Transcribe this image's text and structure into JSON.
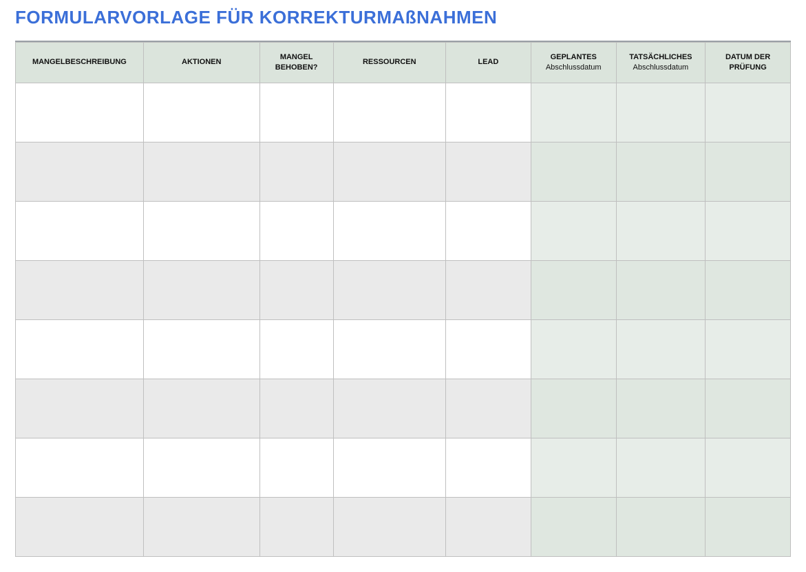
{
  "title": "FORMULARVORLAGE FÜR KORREKTURMAßNAHMEN",
  "columns": [
    {
      "header_bold": "MANGELBESCHREIBUNG",
      "header_sub": ""
    },
    {
      "header_bold": "AKTIONEN",
      "header_sub": ""
    },
    {
      "header_bold": "MANGEL BEHOBEN?",
      "header_sub": ""
    },
    {
      "header_bold": "RESSOURCEN",
      "header_sub": ""
    },
    {
      "header_bold": "LEAD",
      "header_sub": ""
    },
    {
      "header_bold": "GEPLANTES",
      "header_sub": "Abschlussdatum"
    },
    {
      "header_bold": "TATSÄCHLICHES",
      "header_sub": "Abschlussdatum"
    },
    {
      "header_bold": "DATUM DER PRÜFUNG",
      "header_sub": ""
    }
  ],
  "rows": [
    {
      "mangelbeschreibung": "",
      "aktionen": "",
      "mangel_behoben": "",
      "ressourcen": "",
      "lead": "",
      "geplantes_abschlussdatum": "",
      "tatsaechliches_abschlussdatum": "",
      "datum_der_pruefung": ""
    },
    {
      "mangelbeschreibung": "",
      "aktionen": "",
      "mangel_behoben": "",
      "ressourcen": "",
      "lead": "",
      "geplantes_abschlussdatum": "",
      "tatsaechliches_abschlussdatum": "",
      "datum_der_pruefung": ""
    },
    {
      "mangelbeschreibung": "",
      "aktionen": "",
      "mangel_behoben": "",
      "ressourcen": "",
      "lead": "",
      "geplantes_abschlussdatum": "",
      "tatsaechliches_abschlussdatum": "",
      "datum_der_pruefung": ""
    },
    {
      "mangelbeschreibung": "",
      "aktionen": "",
      "mangel_behoben": "",
      "ressourcen": "",
      "lead": "",
      "geplantes_abschlussdatum": "",
      "tatsaechliches_abschlussdatum": "",
      "datum_der_pruefung": ""
    },
    {
      "mangelbeschreibung": "",
      "aktionen": "",
      "mangel_behoben": "",
      "ressourcen": "",
      "lead": "",
      "geplantes_abschlussdatum": "",
      "tatsaechliches_abschlussdatum": "",
      "datum_der_pruefung": ""
    },
    {
      "mangelbeschreibung": "",
      "aktionen": "",
      "mangel_behoben": "",
      "ressourcen": "",
      "lead": "",
      "geplantes_abschlussdatum": "",
      "tatsaechliches_abschlussdatum": "",
      "datum_der_pruefung": ""
    },
    {
      "mangelbeschreibung": "",
      "aktionen": "",
      "mangel_behoben": "",
      "ressourcen": "",
      "lead": "",
      "geplantes_abschlussdatum": "",
      "tatsaechliches_abschlussdatum": "",
      "datum_der_pruefung": ""
    },
    {
      "mangelbeschreibung": "",
      "aktionen": "",
      "mangel_behoben": "",
      "ressourcen": "",
      "lead": "",
      "geplantes_abschlussdatum": "",
      "tatsaechliches_abschlussdatum": "",
      "datum_der_pruefung": ""
    }
  ]
}
